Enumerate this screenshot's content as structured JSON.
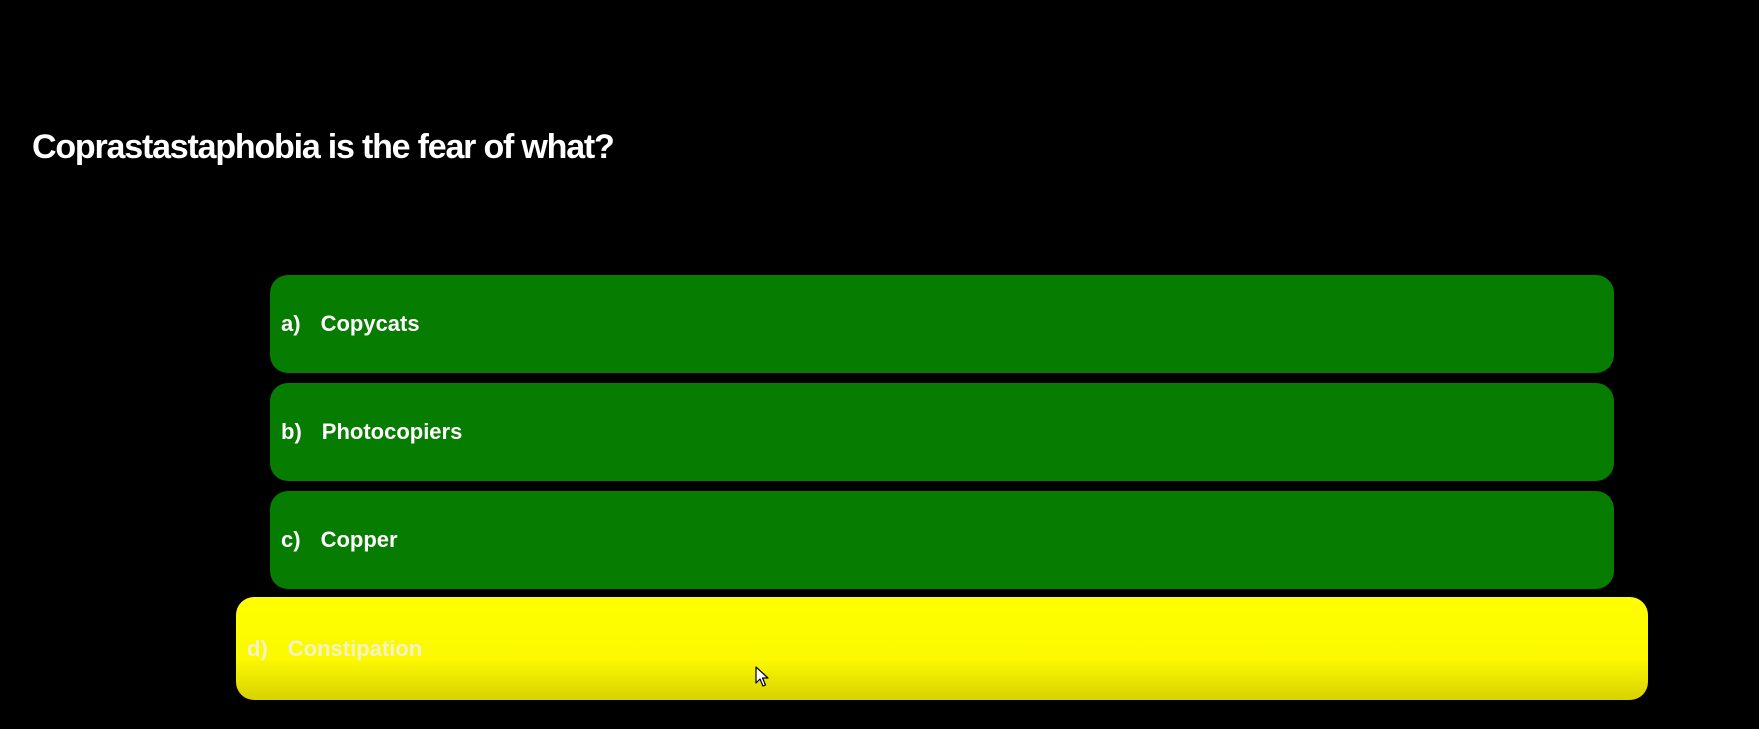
{
  "quiz": {
    "question": "Coprastastaphobia is the fear of what?",
    "answers": [
      {
        "letter": "a)",
        "text": "Copycats",
        "state": "normal"
      },
      {
        "letter": "b)",
        "text": "Photocopiers",
        "state": "normal"
      },
      {
        "letter": "c)",
        "text": "Copper",
        "state": "normal"
      },
      {
        "letter": "d)",
        "text": "Constipation",
        "state": "hovered"
      }
    ]
  },
  "colors": {
    "background": "#000000",
    "answer_normal": "#067c00",
    "answer_hover": "#ffff00",
    "text": "#ffffff"
  },
  "icons": {
    "cursor": "mouse-pointer-icon"
  }
}
